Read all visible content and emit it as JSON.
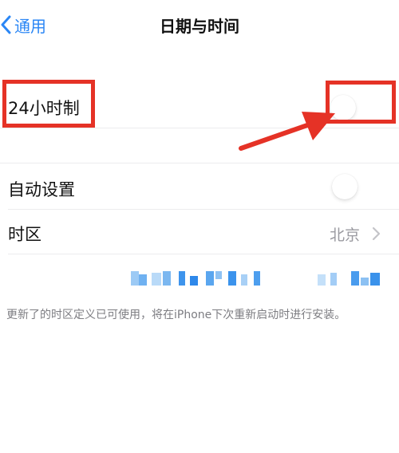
{
  "nav": {
    "back_label": "通用",
    "title": "日期与时间"
  },
  "rows": {
    "hour24": {
      "label": "24小时制",
      "toggle_on": false
    },
    "auto_set": {
      "label": "自动设置",
      "toggle_on": false
    },
    "timezone": {
      "label": "时区",
      "value": "北京"
    }
  },
  "footer_note": "更新了的时区定义已可使用，将在iPhone下次重新启动时进行安装。",
  "colors": {
    "accent": "#2a86f5",
    "annotation_red": "#e53226",
    "blur_blue": "#4aa0ee"
  },
  "icons": [
    "chevron-left-icon",
    "chevron-right-icon",
    "arrow-annotation-icon"
  ]
}
